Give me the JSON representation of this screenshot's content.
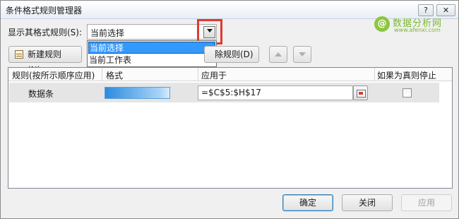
{
  "window": {
    "title": "条件格式规则管理器",
    "help_label": "?",
    "close_label": "✕"
  },
  "watermark": {
    "logo_glyph": "@",
    "name": "数据分析网",
    "url": "www.afenxi.com"
  },
  "show_rules": {
    "label": "显示其格式规则(S):",
    "selected": "当前选择",
    "options": [
      "当前选择",
      "当前工作表"
    ]
  },
  "toolbar": {
    "new_rule_label": "新建规则(N)...",
    "delete_rule_label": "除规则(D)"
  },
  "grid": {
    "columns": [
      "规则(按所示顺序应用)",
      "格式",
      "应用于",
      "如果为真则停止"
    ],
    "rows": [
      {
        "rule": "数据条",
        "applies_to": "=$C$5:$H$17",
        "stop_if_true": false
      }
    ]
  },
  "footer": {
    "ok_label": "确定",
    "close_label": "关闭",
    "apply_label": "应用"
  },
  "colors": {
    "highlight_border": "#e03a2e",
    "dropdown_selection": "#3399ff",
    "databar": "#2b8be0",
    "watermark": "#7ab92e"
  }
}
